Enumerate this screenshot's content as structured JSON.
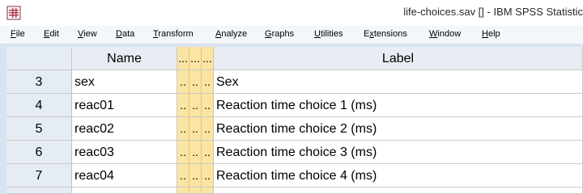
{
  "window": {
    "title": "life-choices.sav [] - IBM SPSS Statistic"
  },
  "menu": [
    {
      "label": "File",
      "ul": "F",
      "rest": "ile"
    },
    {
      "label": "Edit",
      "ul": "E",
      "rest": "dit"
    },
    {
      "label": "View",
      "ul": "V",
      "rest": "iew"
    },
    {
      "label": "Data",
      "ul": "D",
      "rest": "ata"
    },
    {
      "label": "Transform",
      "ul": "T",
      "rest": "ransform"
    },
    {
      "label": "Analyze",
      "ul": "A",
      "rest": "nalyze"
    },
    {
      "label": "Graphs",
      "ul": "G",
      "rest": "raphs"
    },
    {
      "label": "Utilities",
      "ul": "U",
      "rest": "tilities"
    },
    {
      "label": "Extensions",
      "ul": "x",
      "pre": "E",
      "rest": "tensions"
    },
    {
      "label": "Window",
      "ul": "W",
      "rest": "indow"
    },
    {
      "label": "Help",
      "ul": "H",
      "rest": "elp"
    }
  ],
  "grid": {
    "headers": {
      "name": "Name",
      "narrow": [
        "...",
        "...",
        "..."
      ],
      "label": "Label"
    },
    "rows": [
      {
        "num": "3",
        "name": "sex",
        "narrow": [
          "..",
          "..",
          ".."
        ],
        "label": "Sex"
      },
      {
        "num": "4",
        "name": "reac01",
        "narrow": [
          "..",
          "..",
          ".."
        ],
        "label": "Reaction time choice 1 (ms)"
      },
      {
        "num": "5",
        "name": "reac02",
        "narrow": [
          "..",
          "..",
          ".."
        ],
        "label": "Reaction time choice 2 (ms)"
      },
      {
        "num": "6",
        "name": "reac03",
        "narrow": [
          "..",
          "..",
          ".."
        ],
        "label": "Reaction time choice 3 (ms)"
      },
      {
        "num": "7",
        "name": "reac04",
        "narrow": [
          "..",
          "..",
          ".."
        ],
        "label": "Reaction time choice 4 (ms)"
      }
    ]
  },
  "icons": {
    "app": "spss-app-icon"
  }
}
